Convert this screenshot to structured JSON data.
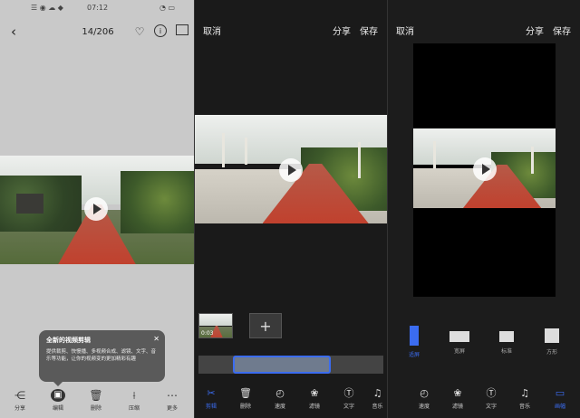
{
  "panel1": {
    "status_time": "07:12",
    "status_icons_left": "☰ ◉ ☁ ◆",
    "status_icons_right": "◔ ▭",
    "counter": "14/206",
    "tooltip": {
      "title": "全新的视频剪辑",
      "body": "提供裁剪、快慢播、多视频合成、滤镜、文字、音乐等功能，让你的视频变的更加精彩有趣",
      "close": "✕"
    },
    "bottom": [
      {
        "label": "分享",
        "icon": "share-icon",
        "glyph": "⋲"
      },
      {
        "label": "编辑",
        "icon": "film-edit-icon",
        "glyph": "▣"
      },
      {
        "label": "删除",
        "icon": "trash-icon",
        "glyph": "🗑"
      },
      {
        "label": "压缩",
        "icon": "compress-icon",
        "glyph": "⟊"
      },
      {
        "label": "更多",
        "icon": "more-icon",
        "glyph": "⋯"
      }
    ]
  },
  "panel2": {
    "cancel": "取消",
    "share": "分享",
    "save": "保存",
    "clip_duration": "0:03",
    "add_glyph": "+",
    "tools": [
      {
        "label": "剪辑",
        "icon": "scissors-icon",
        "glyph": "✂",
        "active": true
      },
      {
        "label": "删除",
        "icon": "trash-icon",
        "glyph": "🗑",
        "active": false
      },
      {
        "label": "速度",
        "icon": "speed-icon",
        "glyph": "◴",
        "active": false
      },
      {
        "label": "滤镜",
        "icon": "filter-icon",
        "glyph": "❀",
        "active": false
      },
      {
        "label": "文字",
        "icon": "text-icon",
        "glyph": "Ⓣ",
        "active": false
      },
      {
        "label": "音乐",
        "icon": "music-icon",
        "glyph": "♫",
        "active": false
      }
    ]
  },
  "panel3": {
    "cancel": "取消",
    "share": "分享",
    "save": "保存",
    "ratios": [
      {
        "label": "适屏",
        "active": true
      },
      {
        "label": "宽屏",
        "active": false
      },
      {
        "label": "标准",
        "active": false
      },
      {
        "label": "方形",
        "active": false
      }
    ],
    "tools": [
      {
        "label": "速度",
        "icon": "speed-icon",
        "glyph": "◴",
        "active": false
      },
      {
        "label": "滤镜",
        "icon": "filter-icon",
        "glyph": "❀",
        "active": false
      },
      {
        "label": "文字",
        "icon": "text-icon",
        "glyph": "Ⓣ",
        "active": false
      },
      {
        "label": "音乐",
        "icon": "music-icon",
        "glyph": "♫",
        "active": false
      },
      {
        "label": "画幅",
        "icon": "frame-icon",
        "glyph": "▭",
        "active": true
      }
    ]
  },
  "colors": {
    "accent": "#3b6cf0",
    "road": "#c0412e"
  }
}
